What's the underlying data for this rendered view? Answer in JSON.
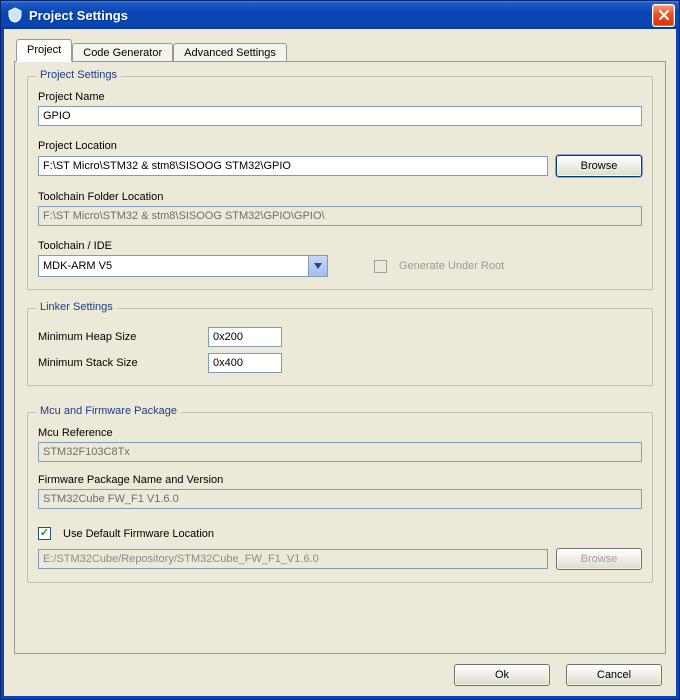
{
  "window": {
    "title": "Project Settings"
  },
  "tabs": {
    "project": "Project",
    "code_gen": "Code Generator",
    "advanced": "Advanced Settings"
  },
  "project_settings": {
    "legend": "Project Settings",
    "name_label": "Project Name",
    "name_value": "GPIO",
    "location_label": "Project Location",
    "location_value": "F:\\ST Micro\\STM32 & stm8\\SISOOG STM32\\GPIO",
    "browse_label": "Browse",
    "toolchain_folder_label": "Toolchain Folder Location",
    "toolchain_folder_value": "F:\\ST Micro\\STM32 & stm8\\SISOOG STM32\\GPIO\\GPIO\\",
    "toolchain_ide_label": "Toolchain / IDE",
    "toolchain_ide_value": "MDK-ARM V5",
    "gen_under_root_label": "Generate Under Root"
  },
  "linker": {
    "legend": "Linker Settings",
    "heap_label": "Minimum Heap Size",
    "heap_value": "0x200",
    "stack_label": "Minimum Stack Size",
    "stack_value": "0x400"
  },
  "mcu": {
    "legend": "Mcu and Firmware Package",
    "ref_label": "Mcu Reference",
    "ref_value": "STM32F103C8Tx",
    "fw_label": "Firmware Package Name and Version",
    "fw_value": "STM32Cube FW_F1 V1.6.0",
    "use_default_label": "Use Default Firmware Location",
    "fw_path_value": "E:/STM32Cube/Repository/STM32Cube_FW_F1_V1.6.0",
    "browse_label": "Browse"
  },
  "footer": {
    "ok": "Ok",
    "cancel": "Cancel"
  }
}
